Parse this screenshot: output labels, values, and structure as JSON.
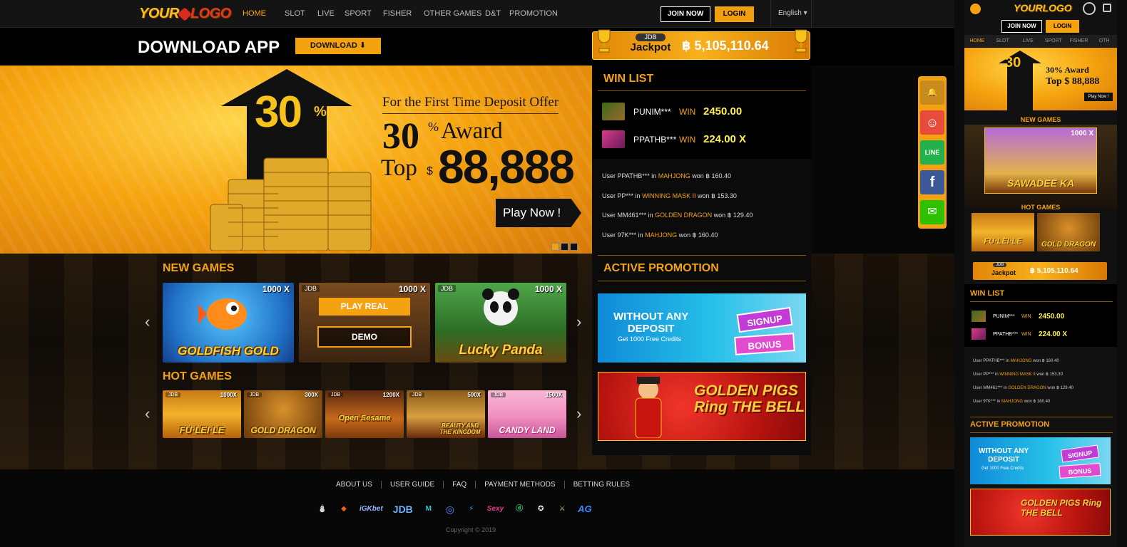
{
  "desktop": {
    "logo": {
      "text_a": "YOUR",
      "text_b": "LOGO"
    },
    "nav": {
      "items": [
        "HOME",
        "SLOT",
        "LIVE",
        "SPORT",
        "FISHER",
        "OTHER GAMES",
        "D&T",
        "PROMOTION"
      ],
      "active_index": 0,
      "join_label": "JOIN NOW",
      "login_label": "LOGIN",
      "language": "English ▾"
    },
    "download": {
      "title": "DOWNLOAD APP",
      "button": "DOWNLOAD ⬇"
    },
    "jackpot": {
      "brand": "JDB",
      "label": "Jackpot",
      "amount": "฿ 5,105,110.64"
    },
    "banner": {
      "percent": "30",
      "percent_sign": "%",
      "offer": "For the First Time Deposit Offer",
      "award_num": "30",
      "award_pct": "%",
      "award_word": "Award",
      "top_word": "Top",
      "top_currency": "$",
      "top_amount": "88,888",
      "play_label": "Play Now !",
      "slides": 3,
      "active_slide": 0
    },
    "new_games": {
      "title": "NEW GAMES",
      "games": [
        {
          "name": "GOLDFISH GOLD",
          "multiplier": "1000 X",
          "brand": "",
          "hover": false
        },
        {
          "name": "",
          "multiplier": "1000 X",
          "brand": "JDB",
          "hover": true,
          "play_real": "PLAY REAL",
          "demo": "DEMO"
        },
        {
          "name": "Lucky Panda",
          "multiplier": "1000 X",
          "brand": "JDB",
          "hover": false
        }
      ]
    },
    "hot_games": {
      "title": "HOT GAMES",
      "games": [
        {
          "name": "FU·LEI·LE",
          "multiplier": "1000X",
          "brand": "JDB"
        },
        {
          "name": "GOLD DRAGON",
          "multiplier": "300X",
          "brand": "JDB"
        },
        {
          "name": "Open Sesame",
          "multiplier": "1200X",
          "brand": "JDB"
        },
        {
          "name": "BEAUTY AND THE KINGDOM",
          "multiplier": "500X",
          "brand": "JDB"
        },
        {
          "name": "CANDY LAND",
          "multiplier": "1500X",
          "brand": "JDB"
        }
      ]
    },
    "win_list": {
      "title": "WIN LIST",
      "top": [
        {
          "user": "PUNIM***",
          "word": "WIN",
          "amount": "2450.00"
        },
        {
          "user": "PPATHB***",
          "word": "WIN",
          "amount": "224.00 X"
        }
      ],
      "log": [
        {
          "user": "PPATHB***",
          "game": "MAHJONG",
          "amount": "฿ 160.40"
        },
        {
          "user": "PP***",
          "game": "WINNING MASK II",
          "amount": "฿ 153.30"
        },
        {
          "user": "MM461***",
          "game": "GOLDEN DRAGON",
          "amount": "฿ 129.40"
        },
        {
          "user": "97K***",
          "game": "MAHJONG",
          "amount": "฿ 160.40"
        }
      ],
      "user_word": "User",
      "in_word": "in",
      "won_word": "won"
    },
    "promotion": {
      "title": "ACTIVE PROMOTION",
      "cards": [
        {
          "line1": "WITHOUT ANY",
          "line2": "DEPOSIT",
          "line3": "Get 1000 Free Credits",
          "badge1": "SIGNUP",
          "badge2": "BONUS"
        },
        {
          "line1": "GOLDEN",
          "line2": "PIGS",
          "line3": "Ring THE BELL"
        }
      ]
    },
    "social": [
      {
        "name": "bell",
        "color": "#c88b1c",
        "glyph": "🔔"
      },
      {
        "name": "support",
        "color": "#e84b3c",
        "glyph": "☺"
      },
      {
        "name": "line",
        "color": "#23b14d",
        "glyph": "LINE"
      },
      {
        "name": "facebook",
        "color": "#3b5998",
        "glyph": "f"
      },
      {
        "name": "wechat",
        "color": "#2dc100",
        "glyph": "✉"
      }
    ],
    "footer": {
      "links": [
        "ABOUT US",
        "USER GUIDE",
        "FAQ",
        "PAYMENT METHODS",
        "BETTING RULES"
      ],
      "providers": [
        "⛄",
        "◆",
        "iGKbet",
        "JDB",
        "M",
        "◎",
        "⚡",
        "Sexy",
        "ⓓ",
        "✪",
        "⚔",
        "AG"
      ],
      "copyright": "Copyright © 2019"
    }
  },
  "mobile": {
    "logo": "YOURLOGO",
    "join_label": "JOIN NOW",
    "login_label": "LOGIN",
    "nav": [
      "HOME",
      "SLOT",
      "LIVE",
      "SPORT",
      "FISHER",
      "OTH"
    ],
    "banner_pct": "30",
    "banner_award": "30% Award",
    "banner_top": "Top $ 88,888",
    "banner_play": "Play Now !",
    "new_games": "NEW GAMES",
    "new_game_name": "SAWADEE KA",
    "new_game_mult": "1000 X",
    "hot_games": "HOT GAMES",
    "hot_a": "FU·LEI·LE",
    "hot_b": "GOLD DRAGON",
    "jackpot_brand": "JDB",
    "jackpot_label": "Jackpot",
    "jackpot_amount": "฿ 5,105,110.64",
    "win_title": "WIN LIST",
    "promo_title": "ACTIVE PROMOTION",
    "promo_1a": "WITHOUT ANY",
    "promo_1b": "DEPOSIT",
    "promo_1c": "Get 1000 Free Credits",
    "promo_badge1": "SIGNUP",
    "promo_badge2": "BONUS",
    "promo_2": "GOLDEN PIGS Ring THE BELL"
  },
  "colors": {
    "accent": "#f4a20f",
    "gold": "#f7c21b",
    "background": "#070707"
  }
}
